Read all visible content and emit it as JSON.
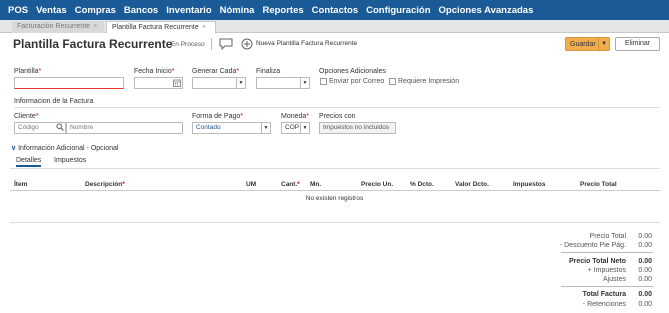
{
  "nav": [
    "POS",
    "Ventas",
    "Compras",
    "Bancos",
    "Inventario",
    "Nómina",
    "Reportes",
    "Contactos",
    "Configuración",
    "Opciones Avanzadas"
  ],
  "tabs": [
    {
      "label": "Facturación Recurrente",
      "close": "×"
    },
    {
      "label": "Plantilla Factura Recurrente",
      "close": "×"
    }
  ],
  "header": {
    "title": "Plantilla Factura Recurrente",
    "status": "- En Proceso",
    "new_link": "Nueva Plantilla Factura Recurrente",
    "save_label": "Guardar",
    "cancel_label": "Eliminar"
  },
  "form": {
    "plantilla_label": "Plantilla",
    "fecha_inicio_label": "Fecha Inicio",
    "generar_cada_label": "Generar Cada",
    "finaliza_label": "Finaliza",
    "opciones_label": "Opciones Adicionales",
    "enviar_correo": "Enviar por Correo",
    "requiere_impresion": "Requiere Impresión",
    "info_factura": "Informacion de la Factura",
    "cliente_label": "Cliente",
    "codigo_placeholder": "Código",
    "nombre_placeholder": "Nombre",
    "forma_pago_label": "Forma de Pago",
    "forma_pago_value": "Contado",
    "moneda_label": "Moneda",
    "moneda_value": "COP",
    "precios_label": "Precios con",
    "precios_value": "Impuestos no incluidos",
    "req_mark": "*"
  },
  "info_adicional": {
    "chevron": "∨",
    "label": "Información Adicional - Opcional"
  },
  "subtabs": [
    "Detalles",
    "Impuestos"
  ],
  "table": {
    "columns": [
      "Ítem",
      "Descripción",
      "UM",
      "Cant.",
      "Mn.",
      "Precio Un.",
      "% Dcto.",
      "Valor Dcto.",
      "Impuestos",
      "Precio Total"
    ],
    "empty": "No existen registros"
  },
  "totals": [
    {
      "label": "Precio Total",
      "value": "0.00"
    },
    {
      "label": "- Descuento Pie Pág.",
      "value": "0.00"
    },
    {
      "label": "Precio Total Neto",
      "value": "0.00"
    },
    {
      "label": "+ Impuestos",
      "value": "0.00"
    },
    {
      "label": "Ajustes",
      "value": "0.00"
    },
    {
      "label": "Total Factura",
      "value": "0.00"
    },
    {
      "label": "- Retenciones",
      "value": "0.00"
    }
  ],
  "colors": {
    "nav": "#1a5a96",
    "save": "#f0ad4e"
  }
}
